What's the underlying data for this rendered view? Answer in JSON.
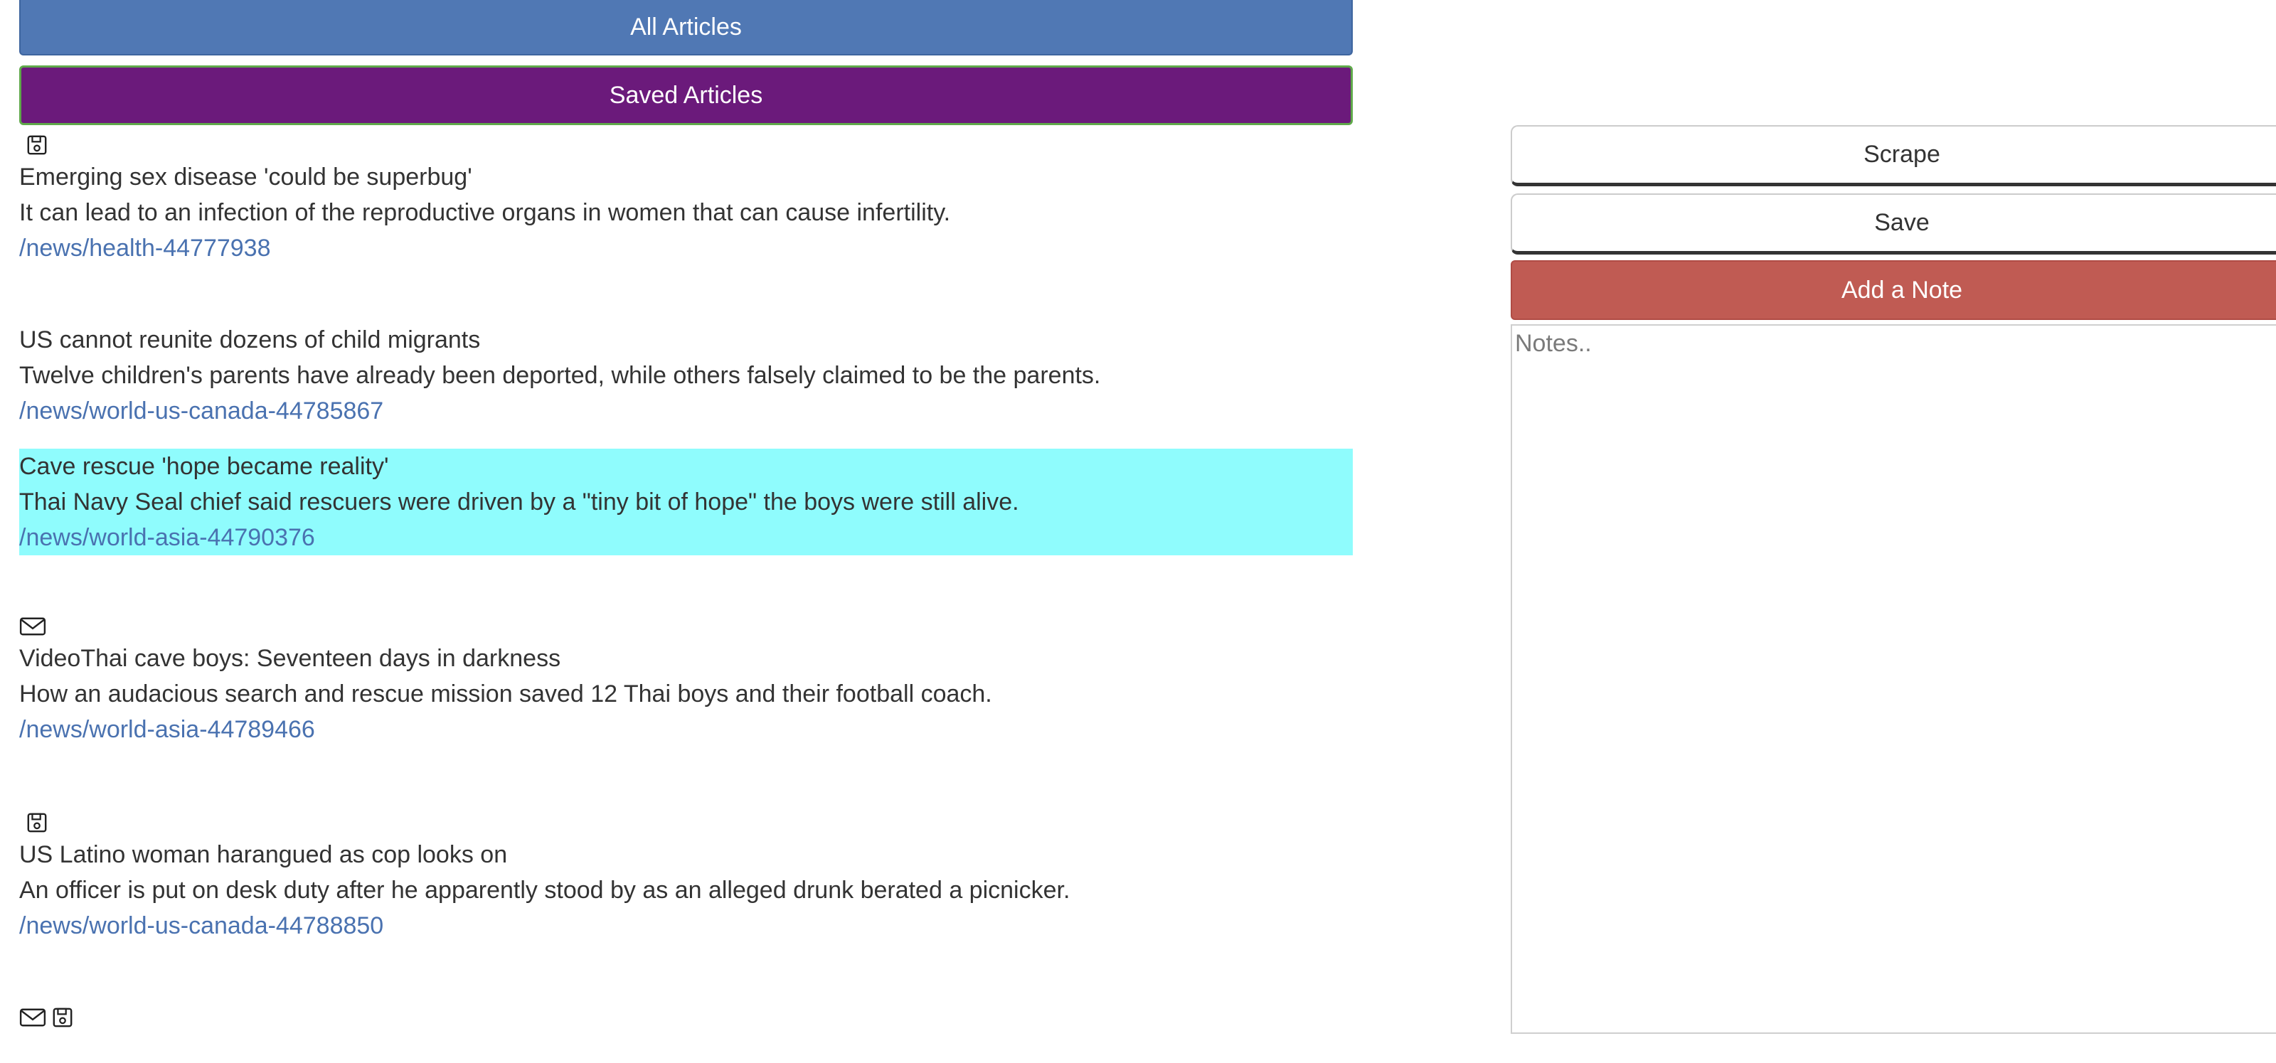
{
  "nav": {
    "all_articles_label": "All Articles",
    "saved_articles_label": "Saved Articles"
  },
  "articles": [
    {
      "icons": [
        "save-icon"
      ],
      "title": "Emerging sex disease 'could be superbug'",
      "summary": "It can lead to an infection of the reproductive organs in women that can cause infertility.",
      "link": "/news/health-44777938",
      "highlighted": false
    },
    {
      "icons": [],
      "title": "US cannot reunite dozens of child migrants",
      "summary": "Twelve children's parents have already been deported, while others falsely claimed to be the parents.",
      "link": "/news/world-us-canada-44785867",
      "highlighted": false
    },
    {
      "icons": [],
      "title": "Cave rescue 'hope became reality'",
      "summary": "Thai Navy Seal chief said rescuers were driven by a \"tiny bit of hope\" the boys were still alive.",
      "link": "/news/world-asia-44790376",
      "highlighted": true
    },
    {
      "icons": [
        "mail-icon"
      ],
      "title": "VideoThai cave boys: Seventeen days in darkness",
      "summary": "How an audacious search and rescue mission saved 12 Thai boys and their football coach.",
      "link": "/news/world-asia-44789466",
      "highlighted": false
    },
    {
      "icons": [
        "save-icon"
      ],
      "title": "US Latino woman harangued as cop looks on",
      "summary": "An officer is put on desk duty after he apparently stood by as an alleged drunk berated a picnicker.",
      "link": "/news/world-us-canada-44788850",
      "highlighted": false
    },
    {
      "icons": [
        "mail-icon",
        "save-icon"
      ],
      "title": "",
      "summary": "",
      "link": "",
      "highlighted": false
    }
  ],
  "sidebar": {
    "scrape_label": "Scrape",
    "save_label": "Save",
    "add_note_label": "Add a Note",
    "notes_placeholder": "Notes.."
  },
  "colors": {
    "all_articles_bg": "#5078b4",
    "saved_articles_bg": "#6b1a7b",
    "add_note_bg": "#c05b53",
    "highlight_bg": "#8ffcfd",
    "link": "#4a72b0"
  }
}
